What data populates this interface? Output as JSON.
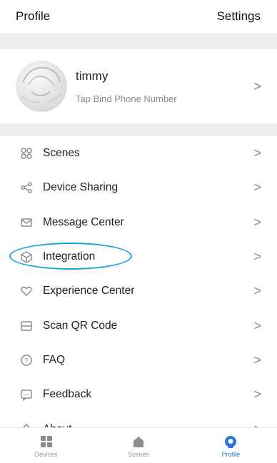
{
  "header": {
    "title": "Profile",
    "settings": "Settings"
  },
  "profile": {
    "name": "timmy",
    "subtitle": "Tap Bind Phone Number"
  },
  "menu": {
    "items": [
      {
        "label": "Scenes",
        "icon": "scenes-icon"
      },
      {
        "label": "Device Sharing",
        "icon": "share-icon"
      },
      {
        "label": "Message Center",
        "icon": "message-icon"
      },
      {
        "label": "Integration",
        "icon": "cube-icon"
      },
      {
        "label": "Experience Center",
        "icon": "heart-icon"
      },
      {
        "label": "Scan QR Code",
        "icon": "scan-icon"
      },
      {
        "label": "FAQ",
        "icon": "help-icon"
      },
      {
        "label": "Feedback",
        "icon": "feedback-icon"
      },
      {
        "label": "About",
        "icon": "diamond-icon"
      }
    ],
    "chevron": ">"
  },
  "tabbar": {
    "tabs": [
      {
        "label": "Devices",
        "icon": "grid-icon",
        "active": false
      },
      {
        "label": "Scenes",
        "icon": "home-icon",
        "active": false
      },
      {
        "label": "Profile",
        "icon": "user-icon",
        "active": true
      }
    ]
  },
  "colors": {
    "accent": "#2a73d8",
    "highlight": "#1aa3d6",
    "section_gap": "#efefef"
  }
}
